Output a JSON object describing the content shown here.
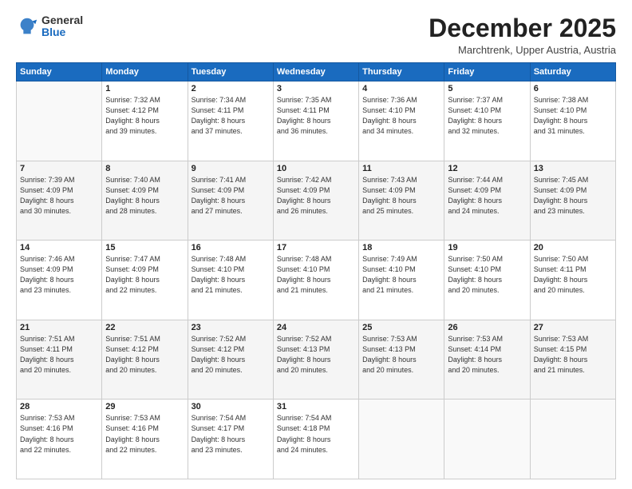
{
  "header": {
    "logo_general": "General",
    "logo_blue": "Blue",
    "month_title": "December 2025",
    "location": "Marchtrenk, Upper Austria, Austria"
  },
  "days_of_week": [
    "Sunday",
    "Monday",
    "Tuesday",
    "Wednesday",
    "Thursday",
    "Friday",
    "Saturday"
  ],
  "weeks": [
    [
      {
        "day": "",
        "info": ""
      },
      {
        "day": "1",
        "info": "Sunrise: 7:32 AM\nSunset: 4:12 PM\nDaylight: 8 hours\nand 39 minutes."
      },
      {
        "day": "2",
        "info": "Sunrise: 7:34 AM\nSunset: 4:11 PM\nDaylight: 8 hours\nand 37 minutes."
      },
      {
        "day": "3",
        "info": "Sunrise: 7:35 AM\nSunset: 4:11 PM\nDaylight: 8 hours\nand 36 minutes."
      },
      {
        "day": "4",
        "info": "Sunrise: 7:36 AM\nSunset: 4:10 PM\nDaylight: 8 hours\nand 34 minutes."
      },
      {
        "day": "5",
        "info": "Sunrise: 7:37 AM\nSunset: 4:10 PM\nDaylight: 8 hours\nand 32 minutes."
      },
      {
        "day": "6",
        "info": "Sunrise: 7:38 AM\nSunset: 4:10 PM\nDaylight: 8 hours\nand 31 minutes."
      }
    ],
    [
      {
        "day": "7",
        "info": "Sunrise: 7:39 AM\nSunset: 4:09 PM\nDaylight: 8 hours\nand 30 minutes."
      },
      {
        "day": "8",
        "info": "Sunrise: 7:40 AM\nSunset: 4:09 PM\nDaylight: 8 hours\nand 28 minutes."
      },
      {
        "day": "9",
        "info": "Sunrise: 7:41 AM\nSunset: 4:09 PM\nDaylight: 8 hours\nand 27 minutes."
      },
      {
        "day": "10",
        "info": "Sunrise: 7:42 AM\nSunset: 4:09 PM\nDaylight: 8 hours\nand 26 minutes."
      },
      {
        "day": "11",
        "info": "Sunrise: 7:43 AM\nSunset: 4:09 PM\nDaylight: 8 hours\nand 25 minutes."
      },
      {
        "day": "12",
        "info": "Sunrise: 7:44 AM\nSunset: 4:09 PM\nDaylight: 8 hours\nand 24 minutes."
      },
      {
        "day": "13",
        "info": "Sunrise: 7:45 AM\nSunset: 4:09 PM\nDaylight: 8 hours\nand 23 minutes."
      }
    ],
    [
      {
        "day": "14",
        "info": "Sunrise: 7:46 AM\nSunset: 4:09 PM\nDaylight: 8 hours\nand 23 minutes."
      },
      {
        "day": "15",
        "info": "Sunrise: 7:47 AM\nSunset: 4:09 PM\nDaylight: 8 hours\nand 22 minutes."
      },
      {
        "day": "16",
        "info": "Sunrise: 7:48 AM\nSunset: 4:10 PM\nDaylight: 8 hours\nand 21 minutes."
      },
      {
        "day": "17",
        "info": "Sunrise: 7:48 AM\nSunset: 4:10 PM\nDaylight: 8 hours\nand 21 minutes."
      },
      {
        "day": "18",
        "info": "Sunrise: 7:49 AM\nSunset: 4:10 PM\nDaylight: 8 hours\nand 21 minutes."
      },
      {
        "day": "19",
        "info": "Sunrise: 7:50 AM\nSunset: 4:10 PM\nDaylight: 8 hours\nand 20 minutes."
      },
      {
        "day": "20",
        "info": "Sunrise: 7:50 AM\nSunset: 4:11 PM\nDaylight: 8 hours\nand 20 minutes."
      }
    ],
    [
      {
        "day": "21",
        "info": "Sunrise: 7:51 AM\nSunset: 4:11 PM\nDaylight: 8 hours\nand 20 minutes."
      },
      {
        "day": "22",
        "info": "Sunrise: 7:51 AM\nSunset: 4:12 PM\nDaylight: 8 hours\nand 20 minutes."
      },
      {
        "day": "23",
        "info": "Sunrise: 7:52 AM\nSunset: 4:12 PM\nDaylight: 8 hours\nand 20 minutes."
      },
      {
        "day": "24",
        "info": "Sunrise: 7:52 AM\nSunset: 4:13 PM\nDaylight: 8 hours\nand 20 minutes."
      },
      {
        "day": "25",
        "info": "Sunrise: 7:53 AM\nSunset: 4:13 PM\nDaylight: 8 hours\nand 20 minutes."
      },
      {
        "day": "26",
        "info": "Sunrise: 7:53 AM\nSunset: 4:14 PM\nDaylight: 8 hours\nand 20 minutes."
      },
      {
        "day": "27",
        "info": "Sunrise: 7:53 AM\nSunset: 4:15 PM\nDaylight: 8 hours\nand 21 minutes."
      }
    ],
    [
      {
        "day": "28",
        "info": "Sunrise: 7:53 AM\nSunset: 4:16 PM\nDaylight: 8 hours\nand 22 minutes."
      },
      {
        "day": "29",
        "info": "Sunrise: 7:53 AM\nSunset: 4:16 PM\nDaylight: 8 hours\nand 22 minutes."
      },
      {
        "day": "30",
        "info": "Sunrise: 7:54 AM\nSunset: 4:17 PM\nDaylight: 8 hours\nand 23 minutes."
      },
      {
        "day": "31",
        "info": "Sunrise: 7:54 AM\nSunset: 4:18 PM\nDaylight: 8 hours\nand 24 minutes."
      },
      {
        "day": "",
        "info": ""
      },
      {
        "day": "",
        "info": ""
      },
      {
        "day": "",
        "info": ""
      }
    ]
  ]
}
